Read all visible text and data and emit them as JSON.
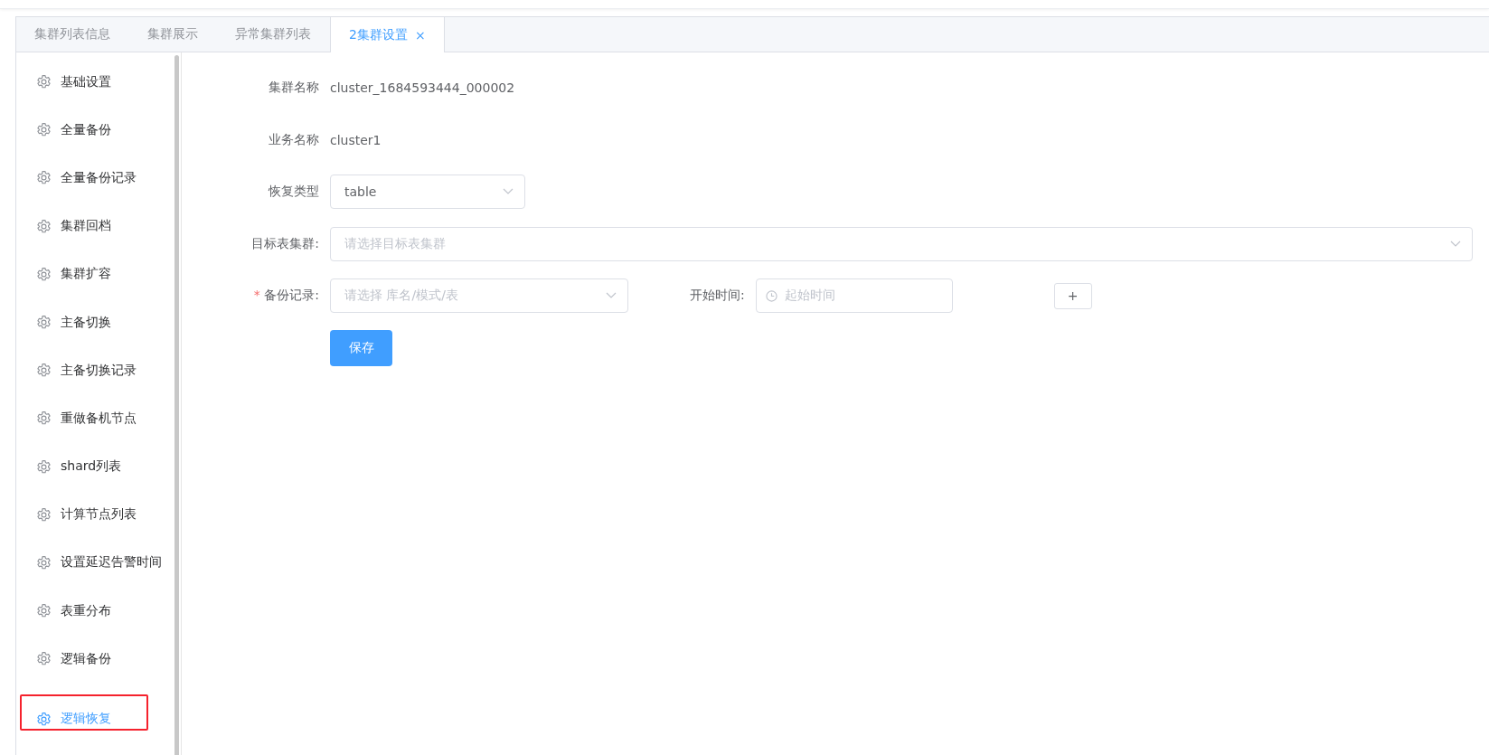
{
  "tabs": [
    {
      "label": "集群列表信息",
      "selected": false,
      "closable": false
    },
    {
      "label": "集群展示",
      "selected": false,
      "closable": false
    },
    {
      "label": "异常集群列表",
      "selected": false,
      "closable": false
    },
    {
      "label": "2集群设置",
      "selected": true,
      "closable": true,
      "close_glyph": "×"
    }
  ],
  "sidebar": {
    "items": [
      {
        "label": "基础设置",
        "selected": false
      },
      {
        "label": "全量备份",
        "selected": false
      },
      {
        "label": "全量备份记录",
        "selected": false
      },
      {
        "label": "集群回档",
        "selected": false
      },
      {
        "label": "集群扩容",
        "selected": false
      },
      {
        "label": "主备切换",
        "selected": false
      },
      {
        "label": "主备切换记录",
        "selected": false
      },
      {
        "label": "重做备机节点",
        "selected": false
      },
      {
        "label": "shard列表",
        "selected": false
      },
      {
        "label": "计算节点列表",
        "selected": false
      },
      {
        "label": "设置延迟告警时间",
        "selected": false
      },
      {
        "label": "表重分布",
        "selected": false
      },
      {
        "label": "逻辑备份",
        "selected": false
      },
      {
        "label": "逻辑恢复",
        "selected": true
      }
    ]
  },
  "form": {
    "cluster_name": {
      "label": "集群名称",
      "value": "cluster_1684593444_000002"
    },
    "business_name": {
      "label": "业务名称",
      "value": "cluster1"
    },
    "restore_type": {
      "label": "恢复类型",
      "value": "table"
    },
    "target_cluster": {
      "label": "目标表集群:",
      "placeholder": "请选择目标表集群"
    },
    "backup_record": {
      "label": "备份记录:",
      "required": true,
      "required_mark": "*",
      "placeholder": "请选择 库名/模式/表"
    },
    "start_time": {
      "label": "开始时间:",
      "placeholder": "起始时间"
    },
    "add_button": "+",
    "save_button": "保存"
  }
}
